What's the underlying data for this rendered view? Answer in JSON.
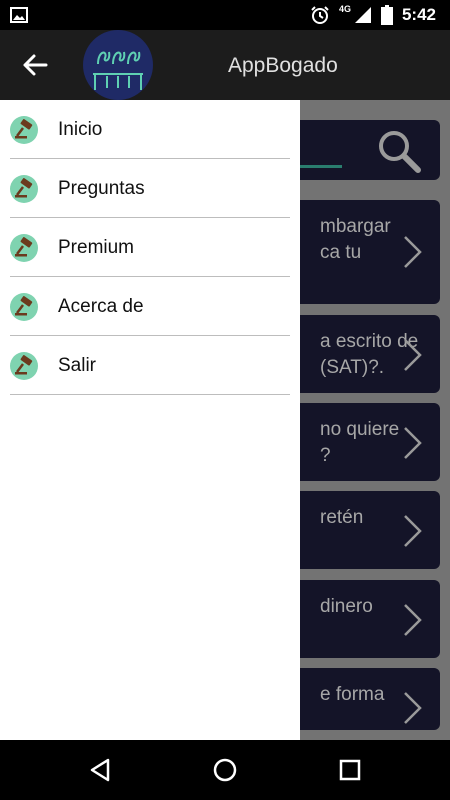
{
  "status_bar": {
    "time": "5:42",
    "network_label": "4G",
    "icons": [
      "image-icon",
      "alarm-icon",
      "signal-icon",
      "battery-icon"
    ]
  },
  "header": {
    "title": "AppBogado",
    "back_icon": "arrow-left-icon",
    "logo_icon": "people-podium-icon"
  },
  "drawer": {
    "items": [
      {
        "label": "Inicio",
        "icon": "gavel-icon"
      },
      {
        "label": "Preguntas",
        "icon": "gavel-icon"
      },
      {
        "label": "Premium",
        "icon": "gavel-icon"
      },
      {
        "label": "Acerca de",
        "icon": "gavel-icon"
      },
      {
        "label": "Salir",
        "icon": "gavel-icon"
      }
    ]
  },
  "background_list": {
    "cards": [
      {
        "line1": "mbargar",
        "line2": "ca tu"
      },
      {
        "line1": "a escrito de",
        "line2": "(SAT)?."
      },
      {
        "line1": "no quiere",
        "line2": "?"
      },
      {
        "line1": "retén",
        "line2": ""
      },
      {
        "line1": "dinero",
        "line2": ""
      },
      {
        "line1": "e forma",
        "line2": ""
      }
    ]
  },
  "colors": {
    "toolbar": "#1c1c1c",
    "card": "#141428",
    "accent": "#2a7d6e",
    "icon_circle": "#7fd3b0",
    "gavel": "#6b3a1e",
    "logo_bg": "#1f2a66"
  },
  "nav_bar": {
    "back": "triangle-back-icon",
    "home": "circle-home-icon",
    "recents": "square-recents-icon"
  }
}
